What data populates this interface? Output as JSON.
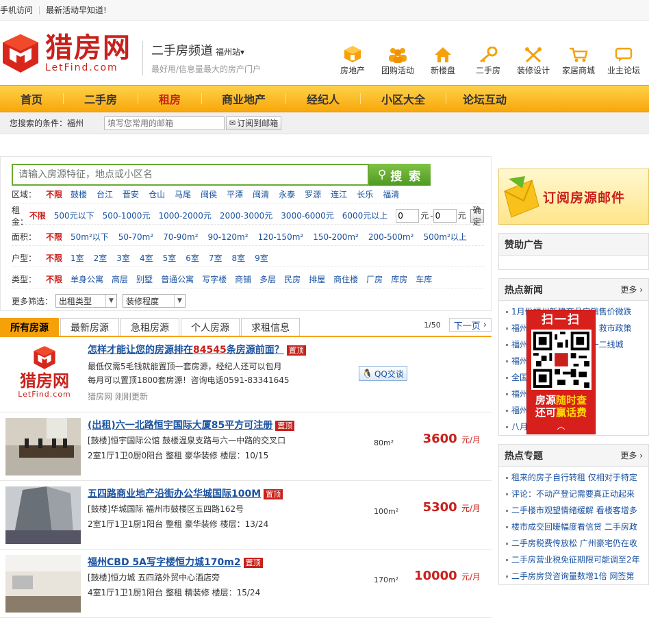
{
  "topbar": {
    "mobile": "手机访问",
    "promo": "最新活动早知道!"
  },
  "logo": {
    "cn": "猎房网",
    "en": "LetFind.com"
  },
  "channel": {
    "title": "二手房频道",
    "city": "福州站",
    "subtitle": "最好用/信息量最大的房产门户"
  },
  "topnav": [
    {
      "label": "房地产",
      "icon": "house-cube-icon"
    },
    {
      "label": "团购活动",
      "icon": "group-icon"
    },
    {
      "label": "新楼盘",
      "icon": "home-icon"
    },
    {
      "label": "二手房",
      "icon": "key-icon"
    },
    {
      "label": "装修设计",
      "icon": "tools-icon"
    },
    {
      "label": "家居商城",
      "icon": "cart-icon"
    },
    {
      "label": "业主论坛",
      "icon": "chat-icon"
    }
  ],
  "mainnav": [
    "首页",
    "二手房",
    "租房",
    "商业地产",
    "经纪人",
    "小区大全",
    "论坛互动"
  ],
  "mainnav_active": "租房",
  "condition": {
    "label": "您搜索的条件：福州",
    "email_placeholder": "填写您常用的邮箱",
    "subscribe_btn": "订阅到邮箱"
  },
  "search": {
    "placeholder": "请输入房源特征，地点或小区名",
    "button": "搜 索"
  },
  "filters": {
    "region": {
      "label": "区域：",
      "options": [
        "不限",
        "鼓楼",
        "台江",
        "晋安",
        "仓山",
        "马尾",
        "闽侯",
        "平潭",
        "闽清",
        "永泰",
        "罗源",
        "连江",
        "长乐",
        "福清"
      ]
    },
    "rent": {
      "label": "租金：",
      "options": [
        "不限",
        "500元以下",
        "500-1000元",
        "1000-2000元",
        "2000-3000元",
        "3000-6000元",
        "6000元以上"
      ],
      "min": "0",
      "max": "0",
      "unit": "元",
      "dash": "-",
      "ok": "确定"
    },
    "area": {
      "label": "面积：",
      "options": [
        "不限",
        "50m²以下",
        "50-70m²",
        "70-90m²",
        "90-120m²",
        "120-150m²",
        "150-200m²",
        "200-500m²",
        "500m²以上"
      ]
    },
    "layout": {
      "label": "户型：",
      "options": [
        "不限",
        "1室",
        "2室",
        "3室",
        "4室",
        "5室",
        "6室",
        "7室",
        "8室",
        "9室"
      ]
    },
    "type": {
      "label": "类型：",
      "options": [
        "不限",
        "单身公寓",
        "高层",
        "别墅",
        "普通公寓",
        "写字楼",
        "商铺",
        "多层",
        "民房",
        "排屋",
        "商住楼",
        "厂房",
        "库房",
        "车库"
      ]
    },
    "more_label": "更多筛选：",
    "select1": "出租类型",
    "select2": "装修程度"
  },
  "tabs": [
    "所有房源",
    "最新房源",
    "急租房源",
    "个人房源",
    "求租信息"
  ],
  "pager": {
    "page": "1/50",
    "next": "下一页"
  },
  "ad": {
    "title_a": "怎样才能让您的房源排在",
    "title_num": "84545",
    "title_b": "条房源前面？",
    "badge": "置顶",
    "line1": "最低仅需5毛钱就能置顶一套房源，经纪人还可以包月",
    "line2": "每月可以置顶1800套房源！咨询电话0591-83341645",
    "source": "猎房网",
    "updated": "刚刚更新",
    "qq": "QQ交谈"
  },
  "listings": [
    {
      "title": "(出租)六一北路恒宇国际大厦85平方可注册",
      "badge": "置顶",
      "addr": "[鼓楼]恒宇国际公馆 鼓楼温泉支路与六一中路的交叉口",
      "info": "2室1厅1卫0厨0阳台  整租  豪华装修  楼层：10/15",
      "area": "80m²",
      "price": "3600",
      "unit": "元/月"
    },
    {
      "title": "五四路商业地产沿街办公华城国际100M",
      "badge": "置顶",
      "addr": "[鼓楼]华城国际  福州市鼓楼区五四路162号",
      "info": "2室1厅1卫1厨1阳台  整租  豪华装修  楼层：13/24",
      "area": "100m²",
      "price": "5300",
      "unit": "元/月"
    },
    {
      "title": "福州CBD 5A写字楼恒力城170m2",
      "badge": "置顶",
      "addr": "[鼓楼]恒力城  五四路外贸中心酒店旁",
      "info": "4室1厅1卫1厨1阳台  整租  精装修  楼层：15/24",
      "area": "170m²",
      "price": "10000",
      "unit": "元/月"
    }
  ],
  "subscribe_banner": "订阅房源邮件",
  "sponsor": {
    "title": "赞助广告"
  },
  "hotnews": {
    "title": "热点新闻",
    "more": "更多",
    "items": [
      "1月份福州新建商品房销售价微跌",
      "福州二手房市场回暖 房 救市政策",
      "福州二手房成交量 策 一二线城",
      "福州楼市 明难办 折迁",
      "全国 市出炉 厦",
      "福州 争推新房源",
      "福州 动 还清房贷",
      "八月 国前十位 销"
    ]
  },
  "hottopic": {
    "title": "热点专题",
    "more": "更多",
    "items": [
      "租来的房子自行转租 仅相对于特定",
      "评论：不动产登记需要真正动起来",
      "二手楼市观望情绪缓解 看楼客增多",
      "楼市成交回暖幅度看信贷 二手房政",
      "二手房税费传放松 广州豪宅仍在收",
      "二手房营业税免征期限可能调至2年",
      "二手房房贷咨询量数增1倍 网签第"
    ]
  },
  "qr": {
    "title": "扫一扫",
    "line1a": "房源",
    "line1b": "随时查",
    "line2a": "还可",
    "line2b": "赢话费"
  }
}
